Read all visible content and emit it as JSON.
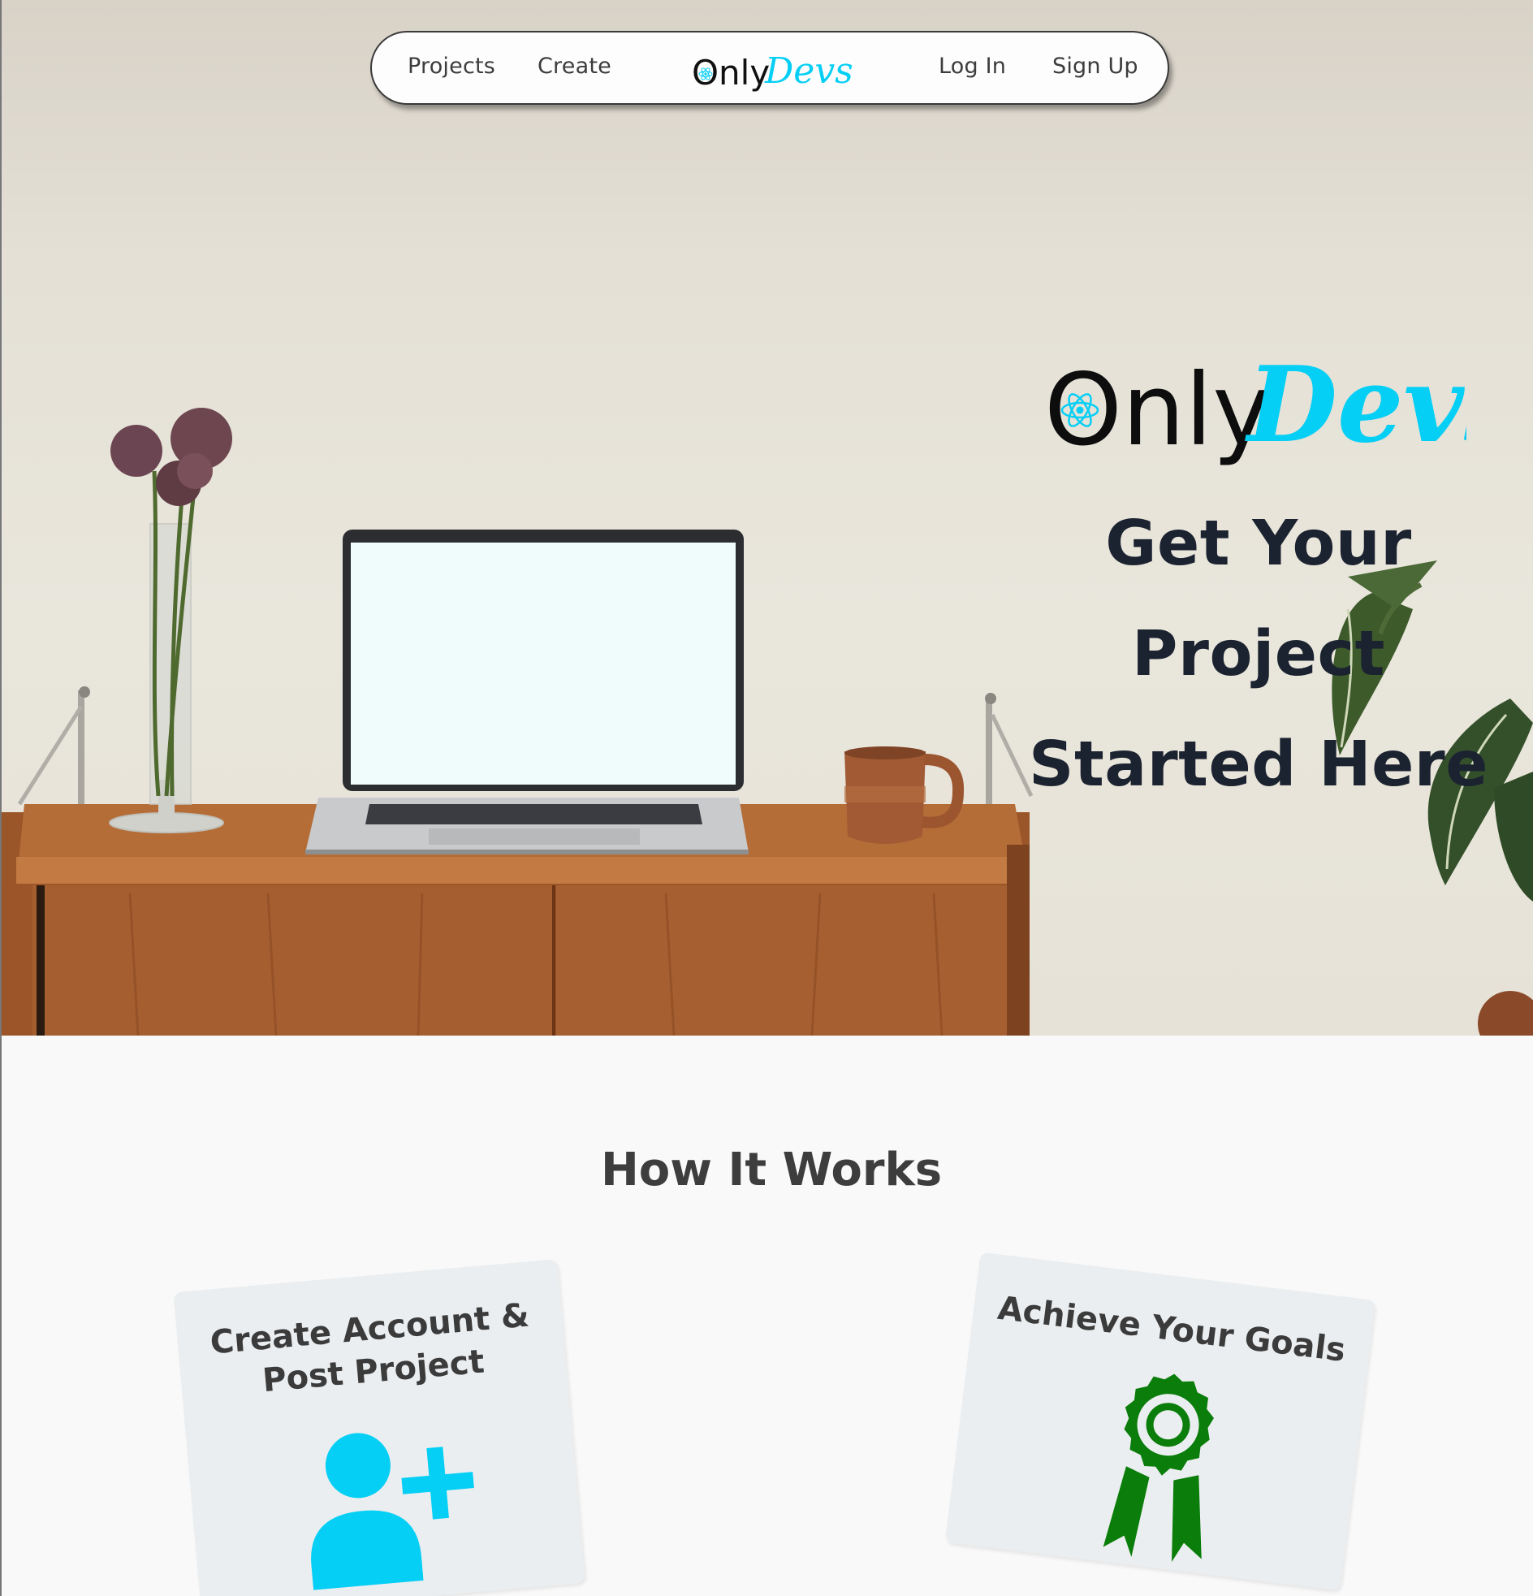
{
  "colors": {
    "accent_cyan": "#06cff5",
    "award_green": "#0a7d0a",
    "tagline_dark": "#1c2330",
    "card_bg": "#ebeef0"
  },
  "navbar": {
    "projects_label": "Projects",
    "create_label": "Create",
    "login_label": "Log In",
    "signup_label": "Sign Up",
    "logo": {
      "only_text": "Only",
      "devs_text": "Devs"
    }
  },
  "hero": {
    "logo": {
      "only_text": "Only",
      "devs_text": "Devs"
    },
    "tagline_line1": "Get Your Project",
    "tagline_line2": "Started Here"
  },
  "how_it_works": {
    "title": "How It Works",
    "cards": [
      {
        "title_line1": "Create Account &",
        "title_line2": "Post Project",
        "icon": "user-plus-icon"
      },
      {
        "title_line1": "Achieve Your Goals",
        "icon": "award-ribbon-icon"
      }
    ]
  }
}
